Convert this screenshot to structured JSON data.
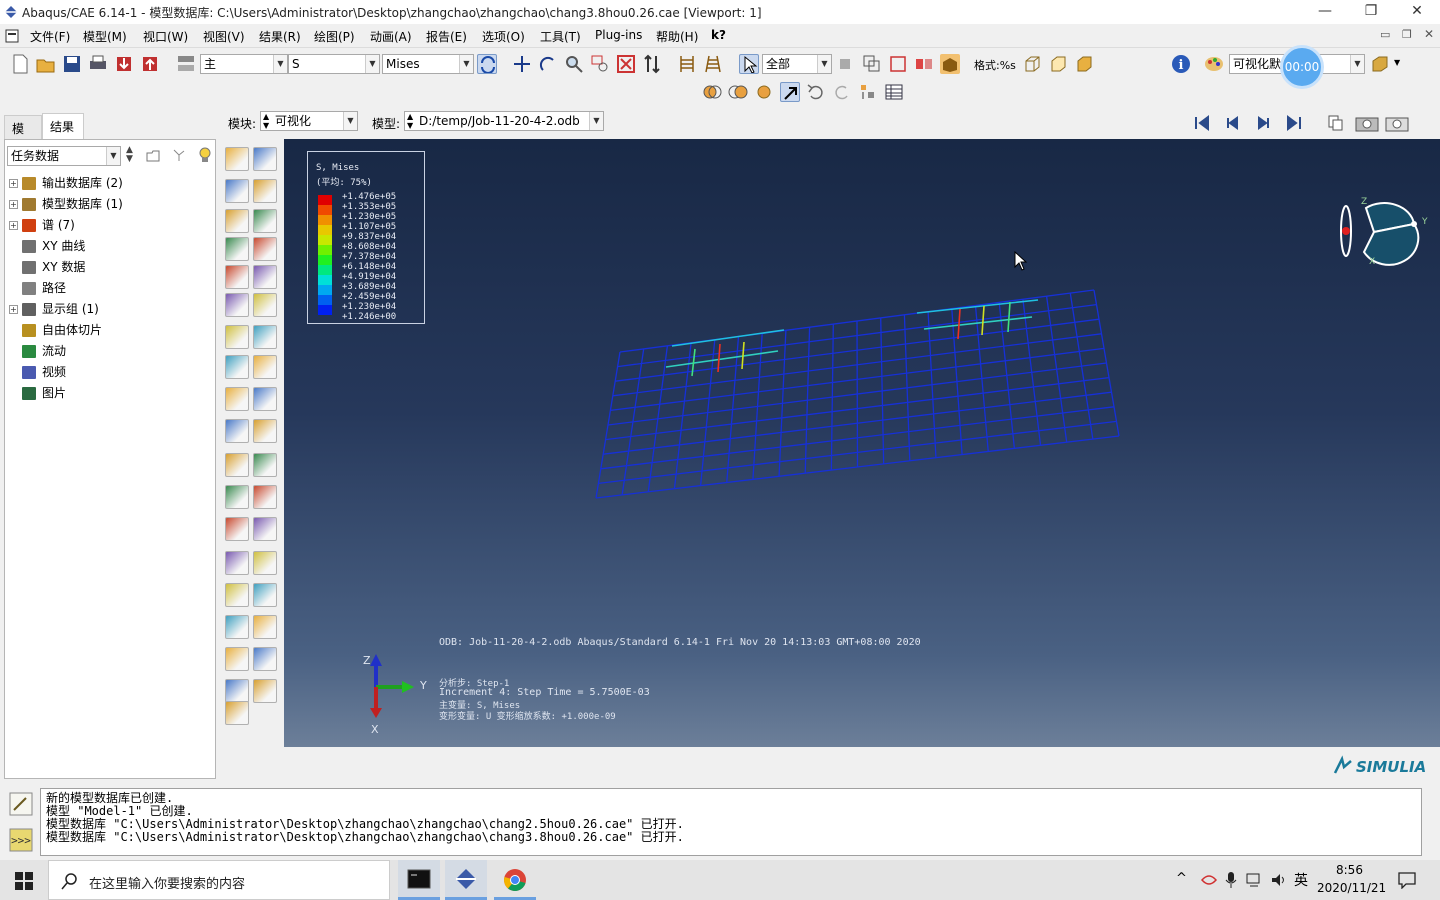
{
  "window": {
    "title": "Abaqus/CAE 6.14-1 - 模型数据库: C:\\Users\\Administrator\\Desktop\\zhangchao\\zhangchao\\chang3.8hou0.26.cae [Viewport: 1]",
    "minimize": "—",
    "restore": "❐",
    "close": "✕"
  },
  "menu": [
    "文件(F)",
    "模型(M)",
    "视口(W)",
    "视图(V)",
    "结果(R)",
    "绘图(P)",
    "动画(A)",
    "报告(E)",
    "选项(O)",
    "工具(T)",
    "Plug-ins",
    "帮助(H)",
    "k?"
  ],
  "toolbar": {
    "step_combo": "主",
    "field_combo": "S",
    "invariant_combo": "Mises",
    "select_combo": "全部",
    "render_label": "格式:%s",
    "visual_combo": "可视化默",
    "timer": "00:00"
  },
  "context": {
    "module_label": "模块:",
    "module_value": "可视化",
    "model_label": "模型:",
    "model_value": "D:/temp/Job-11-20-4-2.odb"
  },
  "tabs": [
    "模型",
    "结果"
  ],
  "tree_filter": "任务数据",
  "tree": [
    {
      "label": "输出数据库 (2)",
      "expand": true,
      "color": "#b88a2a"
    },
    {
      "label": "模型数据库 (1)",
      "expand": true,
      "color": "#a07a30"
    },
    {
      "label": "谱 (7)",
      "expand": true,
      "color": "#d04010"
    },
    {
      "label": "XY 曲线",
      "expand": false,
      "color": "#707070"
    },
    {
      "label": "XY 数据",
      "expand": false,
      "color": "#707070"
    },
    {
      "label": "路径",
      "expand": false,
      "color": "#808080"
    },
    {
      "label": "显示组 (1)",
      "expand": true,
      "color": "#606060"
    },
    {
      "label": "自由体切片",
      "expand": false,
      "color": "#b89020"
    },
    {
      "label": "流动",
      "expand": false,
      "color": "#2a8a40"
    },
    {
      "label": "视频",
      "expand": false,
      "color": "#4a5ab0"
    },
    {
      "label": "图片",
      "expand": false,
      "color": "#2a6a40"
    }
  ],
  "legend": {
    "title": "S, Mises",
    "subtitle": "(平均: 75%)",
    "values": [
      "+1.476e+05",
      "+1.353e+05",
      "+1.230e+05",
      "+1.107e+05",
      "+9.837e+04",
      "+8.608e+04",
      "+7.378e+04",
      "+6.148e+04",
      "+4.919e+04",
      "+3.689e+04",
      "+2.459e+04",
      "+1.230e+04",
      "+1.246e+00"
    ],
    "colors": [
      "#e00000",
      "#f04a00",
      "#f09000",
      "#e8c800",
      "#c8e800",
      "#70f000",
      "#20f020",
      "#00e880",
      "#00e0d8",
      "#00a8f0",
      "#0060f0",
      "#0020f0",
      "#0000d8"
    ]
  },
  "viewport_info": {
    "odb_line": "ODB: Job-11-20-4-2.odb    Abaqus/Standard 6.14-1    Fri Nov 20 14:13:03 GMT+08:00 2020",
    "step_line": "分析步: Step-1",
    "increment_line": "Increment     4: Step Time =   5.7500E-03",
    "primary_line": "主变量: S, Mises",
    "deformed_line": "变形变量: U   变形缩放系数: +1.000e-09",
    "triad": {
      "z": "Z",
      "y": "Y",
      "x": "X"
    }
  },
  "brand": "SIMULIA",
  "messages": [
    "新的模型数据库已创建.",
    "模型 \"Model-1\" 已创建.",
    "模型数据库 \"C:\\Users\\Administrator\\Desktop\\zhangchao\\zhangchao\\chang2.5hou0.26.cae\" 已打开.",
    "模型数据库 \"C:\\Users\\Administrator\\Desktop\\zhangchao\\zhangchao\\chang3.8hou0.26.cae\" 已打开."
  ],
  "taskbar": {
    "search_placeholder": "在这里输入你要搜索的内容",
    "ime": "英",
    "time": "8:56",
    "date": "2020/11/21"
  }
}
